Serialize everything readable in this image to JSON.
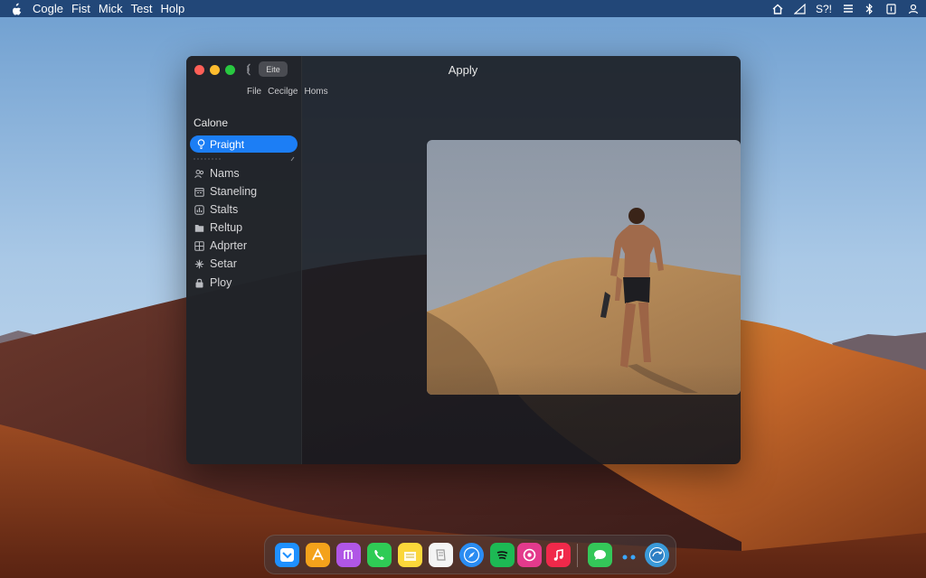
{
  "menubar": {
    "items": [
      "Cogle",
      "Fist",
      "Mick",
      "Test",
      "Holp"
    ],
    "clock": "S?!"
  },
  "window": {
    "title": "Apply",
    "pill_label": "Eite",
    "toolbar": [
      "File",
      "Cecilge",
      "Homs"
    ]
  },
  "sidebar": {
    "heading": "Calone",
    "selected": "Praight",
    "items": [
      {
        "label": "Nams",
        "icon": "people-icon"
      },
      {
        "label": "Staneling",
        "icon": "calendar-icon"
      },
      {
        "label": "Stalts",
        "icon": "chart-icon"
      },
      {
        "label": "Reltup",
        "icon": "folder-icon"
      },
      {
        "label": "Adprter",
        "icon": "grid-icon"
      },
      {
        "label": "Setar",
        "icon": "star-icon"
      },
      {
        "label": "Ploy",
        "icon": "lock-icon"
      }
    ]
  },
  "dock": {
    "apps": [
      "finder-icon",
      "app-store-icon",
      "music-creator-icon",
      "phone-icon",
      "notes-icon",
      "reminders-icon",
      "safari-icon",
      "spotify-icon",
      "podcast-icon",
      "music-icon",
      "messages-icon",
      "more-icon",
      "updater-icon"
    ]
  },
  "colors": {
    "menubar": "#1b3f70",
    "selection": "#1c7ef5",
    "close": "#fe5f57",
    "minimize": "#febc2e",
    "zoom": "#28c840"
  }
}
